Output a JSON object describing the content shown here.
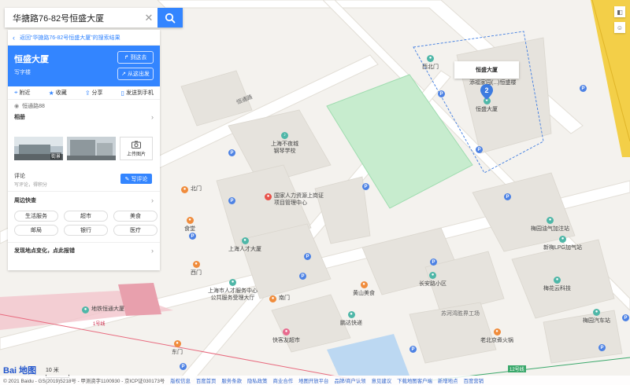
{
  "search": {
    "query": "华搪路76-82号恒盛大厦"
  },
  "panel": {
    "back_link": "返回“华搪路76-82号恒盛大厦”的搜索结果",
    "title": "恒盛大厦",
    "subtitle": "写字楼",
    "go_here": "到这去",
    "from_here": "从这出发",
    "actions": [
      {
        "label": "附近",
        "icon": "pin-icon"
      },
      {
        "label": "收藏",
        "icon": "star-icon"
      },
      {
        "label": "分享",
        "icon": "share-icon"
      },
      {
        "label": "发送到手机",
        "icon": "phone-icon"
      }
    ],
    "address": "恒通路88",
    "album_label": "相册",
    "photo_tag": "街景",
    "upload_label": "上传图片",
    "reviews_label": "评论",
    "reviews_empty": "写评论，得积分",
    "write_review": "写评论",
    "nearby_label": "周边快查",
    "nearby_chips": [
      "生活服务",
      "超市",
      "美食",
      "邮局",
      "银行",
      "医疗"
    ],
    "feedback_label": "发现地点变化，点此报错"
  },
  "map": {
    "infobox_title": "恒盛大厦",
    "marker_number": "2",
    "pois": [
      {
        "name": "上海不夜城\n钢琴学校",
        "color": "teal"
      },
      {
        "name": "国家人力资源上岗证\n项目管理中心",
        "color": "red"
      },
      {
        "name": "上海人才大厦",
        "color": "teal"
      },
      {
        "name": "上海市人才服务中心\n公共服务受理大厅",
        "color": "teal"
      },
      {
        "name": "食堂",
        "color": "orange"
      },
      {
        "name": "北门",
        "color": "orange"
      },
      {
        "name": "西门",
        "color": "orange"
      },
      {
        "name": "南门",
        "color": "orange"
      },
      {
        "name": "东门",
        "color": "orange"
      },
      {
        "name": "恒盛大厦",
        "color": "teal"
      },
      {
        "name": "西北门",
        "color": "teal"
      },
      {
        "name": "添福家园(...)恒盛楼",
        "color": "teal"
      },
      {
        "name": "黄山美食",
        "color": "orange"
      },
      {
        "name": "鹏达快递",
        "color": "teal"
      },
      {
        "name": "长安路小区",
        "color": "teal"
      },
      {
        "name": "梅园油气加注站",
        "color": "teal"
      },
      {
        "name": "新梅LPG加气站",
        "color": "teal"
      },
      {
        "name": "梅花云科技",
        "color": "teal"
      },
      {
        "name": "梅园汽车站",
        "color": "teal"
      },
      {
        "name": "老北京煮火锅",
        "color": "orange"
      },
      {
        "name": "快客友超市",
        "color": "pink"
      },
      {
        "name": "地铁恒通大厦",
        "color": "teal"
      }
    ],
    "streets": [
      "恒通路",
      "苏河湾胜界工场",
      "1号线",
      "12号线"
    ],
    "scale_label": "10 米"
  },
  "footer": {
    "copyright": "© 2021 Baidu - GS(2019)5218号 - 甲测资字1100930 - 京ICP证030173号",
    "links": [
      "版权信息",
      "百度首页",
      "服务条款",
      "隐私政策",
      "商业合作",
      "地图开放平台",
      "品牌/商户认领",
      "意见建议",
      "下载地图客户端",
      "新增地点",
      "百度营销"
    ]
  },
  "brand": {
    "logo": "Bai 地图"
  },
  "colors": {
    "accent": "#3385ff",
    "park": "#c7ecce",
    "park_border": "#8fd9a0",
    "metro": "#e8a0ad",
    "highway": "#f3cf48"
  }
}
